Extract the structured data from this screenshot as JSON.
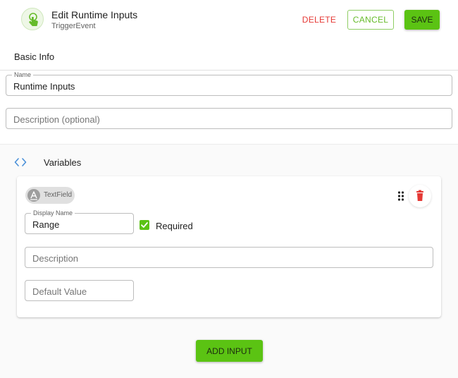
{
  "header": {
    "title": "Edit Runtime Inputs",
    "subtitle": "TriggerEvent",
    "icon": "touch-gesture-icon",
    "delete_label": "DELETE",
    "cancel_label": "CANCEL",
    "save_label": "SAVE"
  },
  "basic_info": {
    "section_label": "Basic Info",
    "name": {
      "label": "Name",
      "value": "Runtime Inputs"
    },
    "description": {
      "placeholder": "Description (optional)"
    }
  },
  "variables": {
    "section_label": "Variables",
    "items": [
      {
        "type_chip": "TextField",
        "display_name": {
          "label": "Display Name",
          "value": "Range"
        },
        "required": {
          "label": "Required",
          "checked": true
        },
        "description": {
          "placeholder": "Description"
        },
        "default_value": {
          "placeholder": "Default Value"
        }
      }
    ]
  },
  "add_input_label": "ADD INPUT",
  "colors": {
    "accent_green": "#5bc313",
    "cancel_green": "#66bb2a",
    "delete_red": "#e53935",
    "code_icon_blue": "#4a90d9"
  }
}
